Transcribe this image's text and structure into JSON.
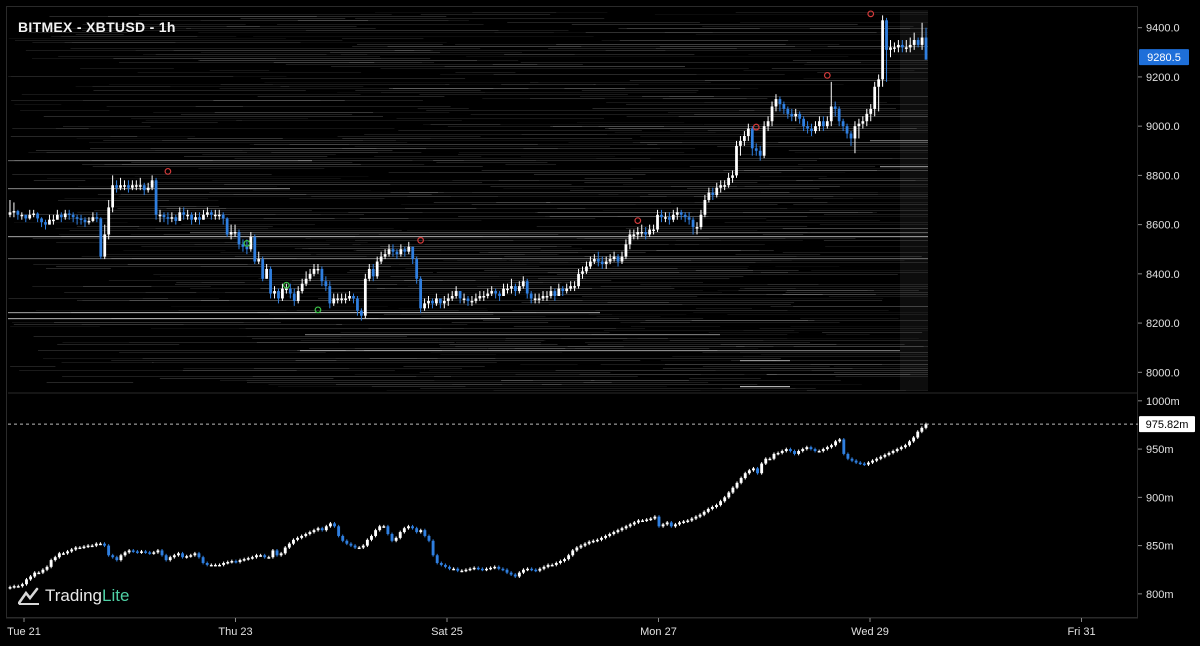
{
  "header": {
    "title": "BITMEX - XBTUSD - 1h"
  },
  "brand": {
    "name_main": "Trading",
    "name_accent": "Lite"
  },
  "colors": {
    "background": "#000000",
    "up_candle": "#ffffff",
    "down_candle": "#2f7fe0",
    "price_tag_bg": "#1e6fd9",
    "cvd_tag_bg": "#ffffff",
    "swing_high_marker": "#d23b3b",
    "swing_low_marker": "#3cc84a"
  },
  "chart_data": [
    {
      "type": "candlestick",
      "title": "BITMEX - XBTUSD - 1h",
      "y_ticks": [
        "9400.0",
        "9200.0",
        "9000.0",
        "8800.0",
        "8600.0",
        "8400.0",
        "8200.0",
        "8000.0"
      ],
      "ylim": [
        7920,
        9480
      ],
      "current_value_label": "9280.5",
      "current_value": 9280.5,
      "series": [
        {
          "name": "close",
          "values": [
            8650,
            8655,
            8640,
            8640,
            8625,
            8640,
            8645,
            8625,
            8610,
            8600,
            8620,
            8620,
            8640,
            8630,
            8645,
            8640,
            8630,
            8625,
            8620,
            8610,
            8615,
            8630,
            8625,
            8470,
            8560,
            8670,
            8760,
            8750,
            8760,
            8760,
            8750,
            8760,
            8760,
            8760,
            8740,
            8750,
            8780,
            8640,
            8640,
            8630,
            8625,
            8630,
            8615,
            8650,
            8640,
            8640,
            8620,
            8630,
            8620,
            8640,
            8650,
            8640,
            8640,
            8640,
            8625,
            8560,
            8570,
            8570,
            8520,
            8510,
            8500,
            8550,
            8450,
            8460,
            8380,
            8420,
            8320,
            8330,
            8300,
            8340,
            8340,
            8320,
            8290,
            8330,
            8360,
            8380,
            8400,
            8420,
            8420,
            8370,
            8350,
            8280,
            8300,
            8300,
            8300,
            8300,
            8310,
            8300,
            8250,
            8230,
            8380,
            8420,
            8390,
            8450,
            8470,
            8480,
            8500,
            8490,
            8480,
            8500,
            8490,
            8510,
            8460,
            8380,
            8260,
            8280,
            8290,
            8280,
            8300,
            8280,
            8290,
            8300,
            8310,
            8330,
            8300,
            8300,
            8290,
            8290,
            8300,
            8310,
            8310,
            8320,
            8330,
            8320,
            8310,
            8340,
            8340,
            8350,
            8330,
            8350,
            8370,
            8320,
            8300,
            8300,
            8300,
            8310,
            8310,
            8330,
            8310,
            8340,
            8330,
            8340,
            8350,
            8350,
            8400,
            8410,
            8430,
            8450,
            8460,
            8450,
            8440,
            8450,
            8460,
            8470,
            8450,
            8470,
            8520,
            8560,
            8560,
            8570,
            8570,
            8560,
            8580,
            8580,
            8640,
            8630,
            8630,
            8620,
            8640,
            8650,
            8640,
            8630,
            8620,
            8590,
            8590,
            8640,
            8700,
            8730,
            8720,
            8750,
            8760,
            8760,
            8790,
            8800,
            8920,
            8940,
            8960,
            8990,
            8910,
            8900,
            8880,
            9000,
            9020,
            9080,
            9110,
            9090,
            9070,
            9050,
            9040,
            9050,
            9030,
            9000,
            8990,
            8980,
            9000,
            9020,
            9000,
            9020,
            9080,
            9070,
            9020,
            9000,
            8970,
            8950,
            9000,
            9010,
            9020,
            9050,
            9070,
            9160,
            9190,
            9430,
            9310,
            9320,
            9320,
            9330,
            9320,
            9320,
            9330,
            9350,
            9330,
            9360,
            9270
          ]
        },
        {
          "name": "high",
          "values": [
            8700,
            8690,
            8660,
            8650,
            8640,
            8660,
            8660,
            8650,
            8630,
            8620,
            8640,
            8640,
            8660,
            8650,
            8660,
            8660,
            8650,
            8640,
            8640,
            8630,
            8630,
            8650,
            8650,
            8630,
            8600,
            8700,
            8800,
            8780,
            8790,
            8780,
            8780,
            8780,
            8780,
            8790,
            8770,
            8770,
            8800,
            8790,
            8660,
            8650,
            8650,
            8650,
            8640,
            8670,
            8670,
            8660,
            8650,
            8650,
            8650,
            8660,
            8670,
            8660,
            8660,
            8660,
            8650,
            8630,
            8600,
            8600,
            8580,
            8540,
            8540,
            8570,
            8560,
            8490,
            8470,
            8440,
            8430,
            8350,
            8340,
            8360,
            8360,
            8360,
            8340,
            8350,
            8380,
            8410,
            8420,
            8440,
            8440,
            8430,
            8390,
            8370,
            8320,
            8320,
            8320,
            8320,
            8330,
            8320,
            8310,
            8260,
            8400,
            8440,
            8440,
            8470,
            8490,
            8500,
            8520,
            8520,
            8500,
            8520,
            8510,
            8530,
            8510,
            8470,
            8390,
            8300,
            8310,
            8300,
            8320,
            8300,
            8310,
            8320,
            8330,
            8350,
            8330,
            8320,
            8310,
            8310,
            8320,
            8330,
            8330,
            8340,
            8350,
            8340,
            8330,
            8360,
            8360,
            8380,
            8360,
            8370,
            8390,
            8380,
            8330,
            8320,
            8320,
            8330,
            8330,
            8350,
            8340,
            8360,
            8350,
            8360,
            8370,
            8370,
            8420,
            8430,
            8450,
            8470,
            8480,
            8490,
            8470,
            8470,
            8480,
            8490,
            8480,
            8490,
            8540,
            8580,
            8580,
            8590,
            8600,
            8590,
            8600,
            8600,
            8660,
            8660,
            8650,
            8650,
            8660,
            8670,
            8660,
            8650,
            8650,
            8630,
            8610,
            8660,
            8720,
            8750,
            8750,
            8770,
            8780,
            8780,
            8810,
            8820,
            8940,
            8960,
            8980,
            9010,
            9000,
            8930,
            8920,
            9020,
            9040,
            9100,
            9130,
            9120,
            9100,
            9080,
            9070,
            9070,
            9060,
            9040,
            9020,
            9010,
            9020,
            9040,
            9040,
            9040,
            9180,
            9100,
            9080,
            9030,
            9010,
            8980,
            9020,
            9030,
            9040,
            9070,
            9090,
            9180,
            9210,
            9450,
            9440,
            9350,
            9340,
            9350,
            9350,
            9350,
            9360,
            9380,
            9360,
            9420,
            9400
          ]
        },
        {
          "name": "low",
          "values": [
            8630,
            8630,
            8620,
            8620,
            8610,
            8620,
            8630,
            8610,
            8590,
            8580,
            8600,
            8600,
            8620,
            8610,
            8620,
            8620,
            8610,
            8600,
            8600,
            8590,
            8600,
            8610,
            8610,
            8460,
            8460,
            8540,
            8650,
            8730,
            8740,
            8740,
            8730,
            8740,
            8740,
            8740,
            8720,
            8730,
            8740,
            8620,
            8610,
            8610,
            8600,
            8610,
            8600,
            8620,
            8620,
            8620,
            8600,
            8610,
            8600,
            8620,
            8630,
            8620,
            8620,
            8620,
            8600,
            8550,
            8540,
            8550,
            8500,
            8490,
            8480,
            8490,
            8440,
            8440,
            8370,
            8380,
            8300,
            8300,
            8280,
            8290,
            8320,
            8300,
            8270,
            8280,
            8320,
            8350,
            8370,
            8390,
            8400,
            8350,
            8330,
            8260,
            8270,
            8280,
            8280,
            8280,
            8290,
            8280,
            8230,
            8210,
            8220,
            8370,
            8370,
            8380,
            8440,
            8460,
            8470,
            8470,
            8460,
            8470,
            8470,
            8480,
            8440,
            8360,
            8240,
            8250,
            8260,
            8260,
            8270,
            8260,
            8260,
            8270,
            8290,
            8300,
            8280,
            8280,
            8270,
            8270,
            8280,
            8290,
            8290,
            8300,
            8310,
            8300,
            8290,
            8310,
            8320,
            8320,
            8310,
            8320,
            8340,
            8300,
            8280,
            8280,
            8280,
            8290,
            8290,
            8300,
            8290,
            8310,
            8310,
            8320,
            8330,
            8330,
            8340,
            8380,
            8400,
            8420,
            8440,
            8430,
            8420,
            8420,
            8440,
            8450,
            8430,
            8440,
            8460,
            8500,
            8540,
            8540,
            8550,
            8540,
            8550,
            8560,
            8570,
            8610,
            8610,
            8600,
            8610,
            8620,
            8620,
            8610,
            8600,
            8560,
            8560,
            8580,
            8630,
            8690,
            8700,
            8710,
            8730,
            8740,
            8750,
            8770,
            8790,
            8880,
            8920,
            8940,
            8880,
            8880,
            8860,
            8870,
            8980,
            9000,
            9060,
            9060,
            9050,
            9030,
            9020,
            9020,
            9010,
            8980,
            8970,
            8960,
            8970,
            8980,
            8980,
            8990,
            9000,
            9040,
            9000,
            8980,
            8950,
            8920,
            8890,
            8950,
            8990,
            9000,
            9020,
            9040,
            9060,
            9160,
            9180,
            9280,
            9300,
            9300,
            9300,
            9300,
            9300,
            9310,
            9320,
            9310,
            9300,
            9230
          ]
        }
      ],
      "markers": [
        {
          "kind": "swing-high",
          "x": 40,
          "y": 8800
        },
        {
          "kind": "swing-high",
          "x": 104,
          "y": 8520
        },
        {
          "kind": "swing-high",
          "x": 159,
          "y": 8600
        },
        {
          "kind": "swing-high",
          "x": 189,
          "y": 8980
        },
        {
          "kind": "swing-high",
          "x": 207,
          "y": 9190
        },
        {
          "kind": "swing-high",
          "x": 218,
          "y": 9440
        },
        {
          "kind": "swing-low",
          "x": 60,
          "y": 8540
        },
        {
          "kind": "swing-low",
          "x": 70,
          "y": 8370
        },
        {
          "kind": "swing-low",
          "x": 78,
          "y": 8270
        }
      ]
    },
    {
      "type": "candlestick",
      "title": "",
      "y_ticks": [
        "1000m",
        "950m",
        "900m",
        "850m",
        "800m"
      ],
      "ylim": [
        775,
        1005
      ],
      "current_value_label": "975.82m",
      "current_value": 975.82,
      "series": [
        {
          "name": "close",
          "values": [
            807,
            808,
            808,
            810,
            815,
            818,
            822,
            822,
            825,
            828,
            835,
            838,
            842,
            842,
            844,
            846,
            848,
            848,
            849,
            850,
            850,
            852,
            852,
            850,
            840,
            838,
            835,
            840,
            843,
            845,
            844,
            843,
            844,
            843,
            842,
            843,
            845,
            840,
            835,
            838,
            840,
            842,
            838,
            839,
            840,
            842,
            838,
            832,
            830,
            830,
            830,
            830,
            832,
            833,
            834,
            833,
            835,
            836,
            837,
            838,
            840,
            840,
            838,
            838,
            845,
            840,
            842,
            848,
            852,
            856,
            858,
            860,
            862,
            864,
            866,
            868,
            866,
            870,
            873,
            870,
            860,
            855,
            852,
            850,
            848,
            848,
            850,
            856,
            860,
            866,
            870,
            870,
            862,
            855,
            858,
            864,
            868,
            870,
            868,
            864,
            866,
            860,
            855,
            840,
            832,
            830,
            828,
            826,
            826,
            824,
            824,
            825,
            826,
            827,
            826,
            825,
            826,
            827,
            828,
            826,
            825,
            822,
            820,
            818,
            822,
            825,
            826,
            825,
            824,
            826,
            828,
            830,
            830,
            832,
            834,
            836,
            840,
            845,
            848,
            850,
            852,
            854,
            855,
            856,
            858,
            860,
            862,
            864,
            866,
            868,
            870,
            872,
            874,
            876,
            876,
            877,
            878,
            880,
            870,
            872,
            874,
            870,
            872,
            874,
            875,
            876,
            878,
            880,
            882,
            885,
            888,
            890,
            892,
            896,
            900,
            905,
            910,
            915,
            920,
            925,
            928,
            930,
            925,
            935,
            940,
            940,
            945,
            946,
            948,
            950,
            948,
            945,
            948,
            950,
            952,
            950,
            948,
            948,
            950,
            952,
            954,
            958,
            960,
            945,
            940,
            938,
            936,
            935,
            934,
            936,
            938,
            940,
            942,
            944,
            946,
            948,
            950,
            952,
            954,
            958,
            962,
            968,
            972,
            975.82
          ]
        }
      ]
    }
  ],
  "x_axis": {
    "labels": [
      "Tue 21",
      "Thu 23",
      "Sat 25",
      "Mon 27",
      "Wed 29",
      "Fri 31"
    ]
  }
}
